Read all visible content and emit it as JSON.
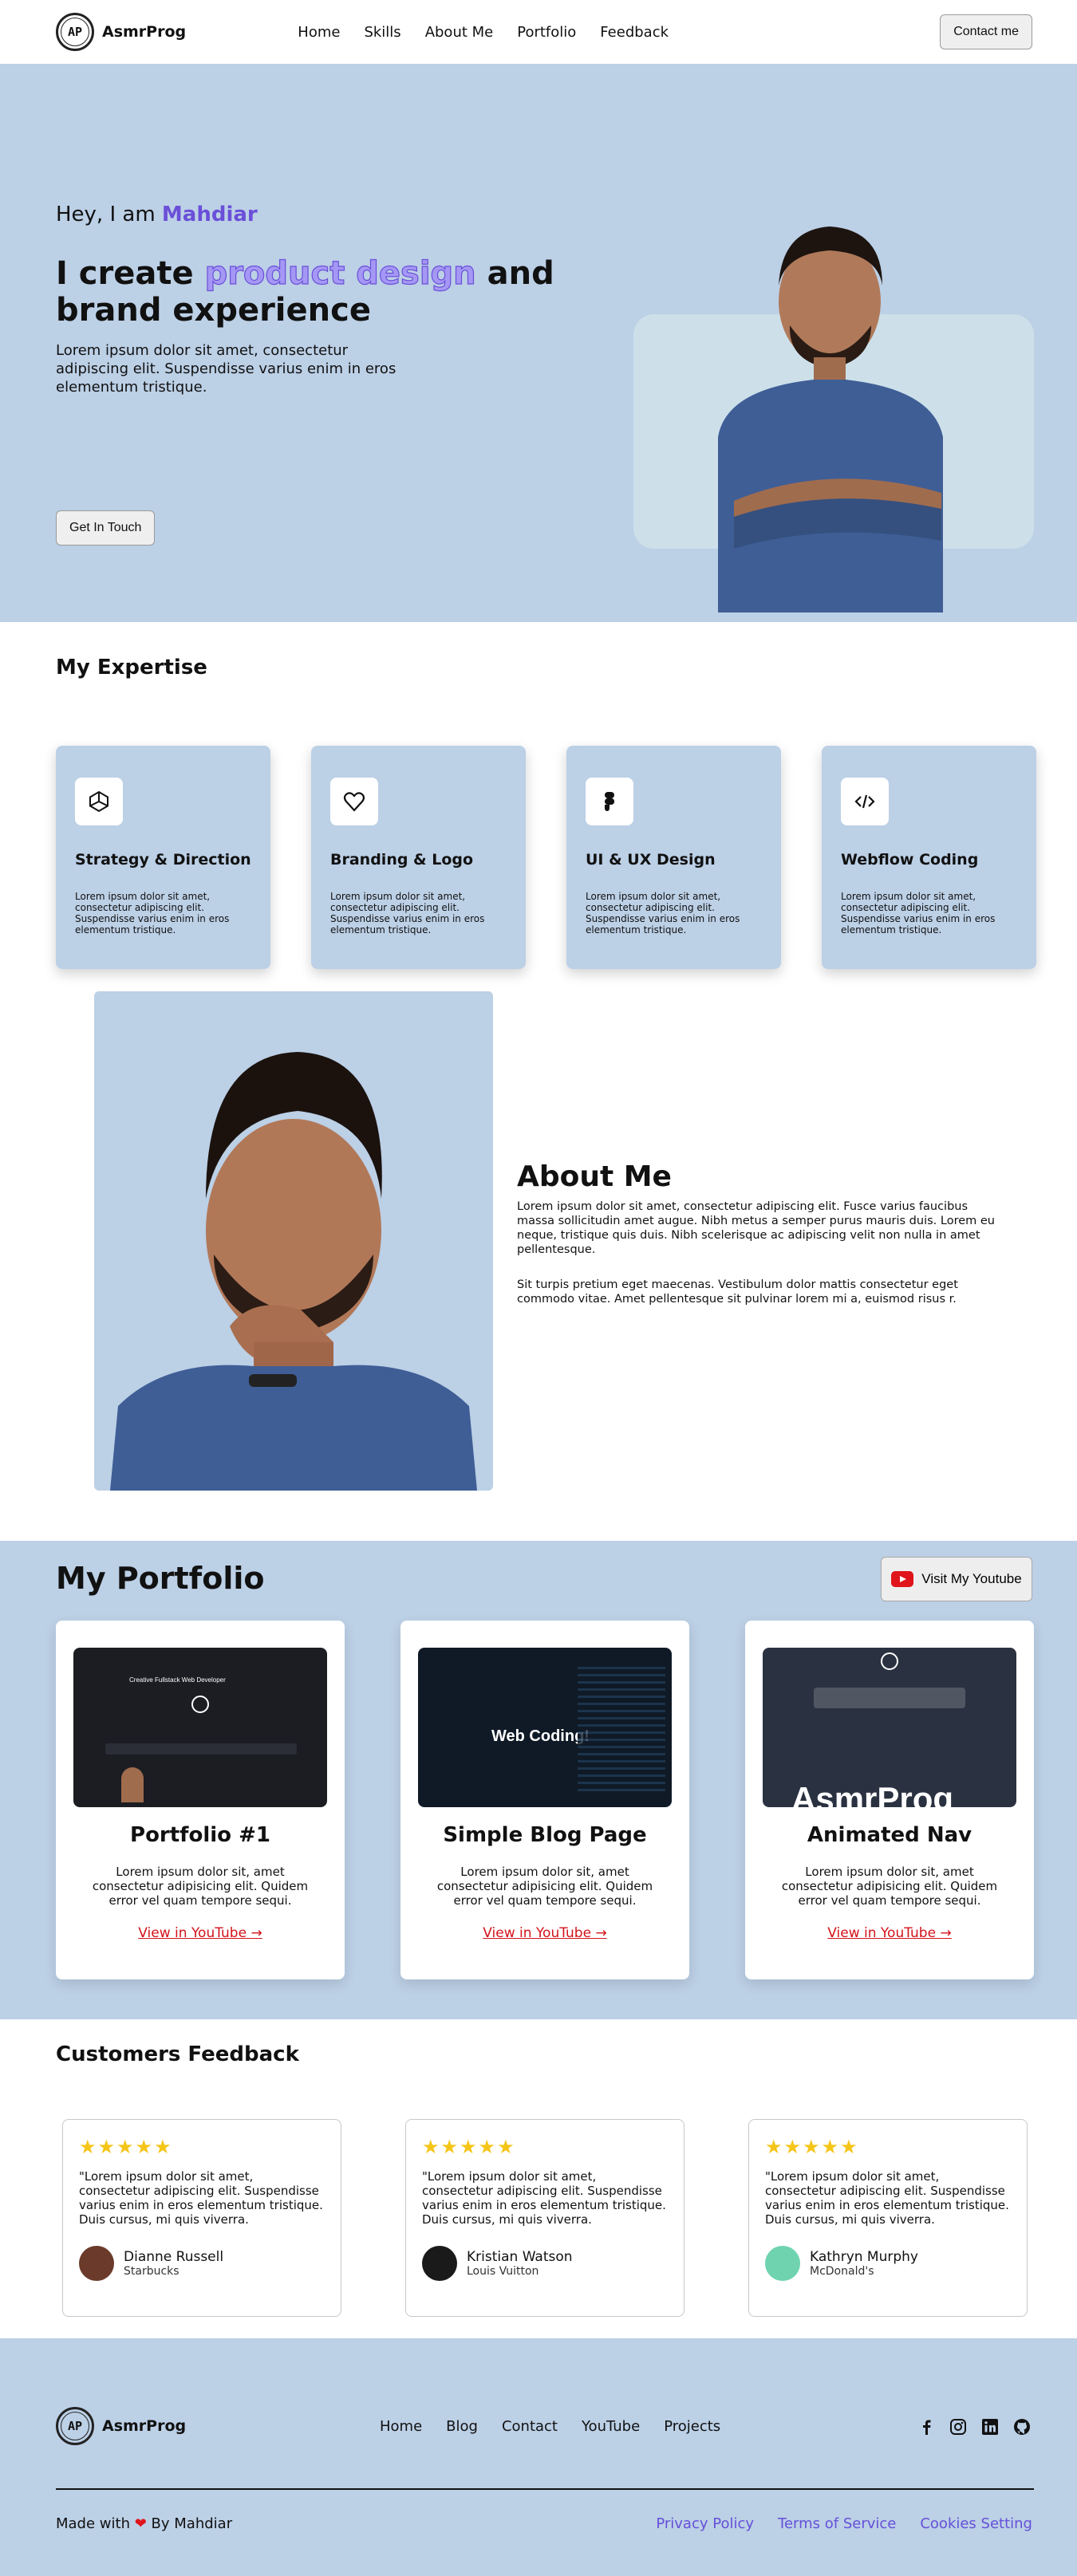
{
  "nav": {
    "logo_text": "AP",
    "brand": "AsmrProg",
    "links": [
      "Home",
      "Skills",
      "About Me",
      "Portfolio",
      "Feedback"
    ],
    "contact_button": "Contact me"
  },
  "hero": {
    "greeting": "Hey, I am",
    "name": "Mahdiar",
    "title_start": "I create",
    "title_highlight": "product design",
    "title_end": "and brand experience",
    "subtitle": "Lorem ipsum dolor sit amet, consectetur adipiscing elit. Suspendisse varius enim in eros elementum tristique.",
    "cta": "Get In Touch"
  },
  "expertise": {
    "title": "My Expertise",
    "items": [
      {
        "name": "Strategy & Direction",
        "icon": "openai-icon",
        "desc": "Lorem ipsum dolor sit amet, consectetur adipiscing elit. Suspendisse varius enim in eros elementum tristique."
      },
      {
        "name": "Branding & Logo",
        "icon": "heart-icon",
        "desc": "Lorem ipsum dolor sit amet, consectetur adipiscing elit. Suspendisse varius enim in eros elementum tristique."
      },
      {
        "name": "UI & UX Design",
        "icon": "figma-icon",
        "desc": "Lorem ipsum dolor sit amet, consectetur adipiscing elit. Suspendisse varius enim in eros elementum tristique."
      },
      {
        "name": "Webflow Coding",
        "icon": "code-icon",
        "desc": "Lorem ipsum dolor sit amet, consectetur adipiscing elit. Suspendisse varius enim in eros elementum tristique."
      }
    ]
  },
  "about": {
    "title": "About Me",
    "p1": "Lorem ipsum dolor sit amet, consectetur adipiscing elit. Fusce varius faucibus massa sollicitudin amet augue. Nibh metus a semper purus mauris duis. Lorem eu neque, tristique quis duis. Nibh scelerisque ac adipiscing velit non nulla in amet pellentesque.",
    "p2": "Sit turpis pretium eget maecenas. Vestibulum dolor mattis consectetur eget commodo vitae. Amet pellentesque sit pulvinar lorem mi a, euismod risus r."
  },
  "portfolio": {
    "title": "My Portfolio",
    "youtube_button": "Visit My Youtube",
    "items": [
      {
        "name": "Portfolio #1",
        "desc": "Lorem ipsum dolor sit, amet consectetur adipisicing elit. Quidem error vel quam tempore sequi.",
        "link": "View in YouTube",
        "shot_title": "Creative Fullstack Web Developer"
      },
      {
        "name": "Simple Blog Page",
        "desc": "Lorem ipsum dolor sit, amet consectetur adipisicing elit. Quidem error vel quam tempore sequi.",
        "link": "View in YouTube",
        "shot_title": "Web Coding!"
      },
      {
        "name": "Animated Nav",
        "desc": "Lorem ipsum dolor sit, amet consectetur adipisicing elit. Quidem error vel quam tempore sequi.",
        "link": "View in YouTube",
        "shot_title": "AsmrProg"
      }
    ]
  },
  "feedback": {
    "title": "Customers Feedback",
    "stars": "★★★★★",
    "items": [
      {
        "quote": "\"Lorem ipsum dolor sit amet, consectetur adipiscing elit. Suspendisse varius enim in eros elementum tristique. Duis cursus, mi quis viverra.",
        "name": "Dianne Russell",
        "company": "Starbucks"
      },
      {
        "quote": "\"Lorem ipsum dolor sit amet, consectetur adipiscing elit. Suspendisse varius enim in eros elementum tristique. Duis cursus, mi quis viverra.",
        "name": "Kristian Watson",
        "company": "Louis Vuitton"
      },
      {
        "quote": "\"Lorem ipsum dolor sit amet, consectetur adipiscing elit. Suspendisse varius enim in eros elementum tristique. Duis cursus, mi quis viverra.",
        "name": "Kathryn Murphy",
        "company": "McDonald's"
      }
    ]
  },
  "footer": {
    "logo_text": "AP",
    "brand": "AsmrProg",
    "links": [
      "Home",
      "Blog",
      "Contact",
      "YouTube",
      "Projects"
    ],
    "socials": [
      "facebook-icon",
      "instagram-icon",
      "linkedin-icon",
      "github-icon"
    ],
    "made_with": "Made with",
    "by": "By Mahdiar",
    "legal": [
      "Privacy Policy",
      "Terms of Service",
      "Cookies Setting"
    ]
  },
  "colors": {
    "accent": "#6a4fd8",
    "section_bg": "#bcd0e6",
    "link_red": "#d3121b"
  }
}
